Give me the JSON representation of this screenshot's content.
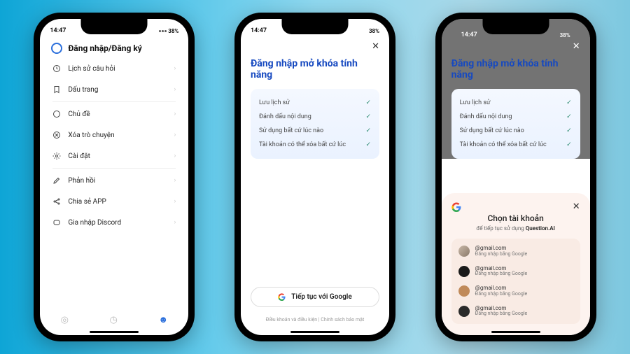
{
  "status": {
    "time": "14:47",
    "battery": "38%"
  },
  "phone1": {
    "header": "Đăng nhập/Đăng ký",
    "items": [
      {
        "label": "Lịch sử câu hỏi"
      },
      {
        "label": "Dấu trang"
      },
      {
        "label": "Chủ đề"
      },
      {
        "label": "Xóa trò chuyện"
      },
      {
        "label": "Cài đặt"
      },
      {
        "label": "Phản hồi"
      },
      {
        "label": "Chia sẻ APP"
      },
      {
        "label": "Gia nhập Discord"
      }
    ]
  },
  "phone2": {
    "title": "Đăng nhập mở khóa tính năng",
    "features": [
      "Lưu lịch sử",
      "Đánh dấu nội dung",
      "Sử dụng bất cứ lúc nào",
      "Tài khoản có thể xóa bất cứ lúc"
    ],
    "google_btn": "Tiếp tục với Google",
    "terms": "Điều khoản và điều kiện | Chính sách bảo mật"
  },
  "phone3": {
    "title": "Đăng nhập mở khóa tính năng",
    "sheet_title": "Chọn tài khoản",
    "sheet_sub_prefix": "để tiếp tục sử dụng ",
    "sheet_sub_app": "Question.AI",
    "account_sub": "Đăng nhập bằng Google",
    "accounts": [
      {
        "email": "@gmail.com"
      },
      {
        "email": "@gmail.com"
      },
      {
        "email": "@gmail.com"
      },
      {
        "email": "@gmail.com"
      }
    ]
  }
}
